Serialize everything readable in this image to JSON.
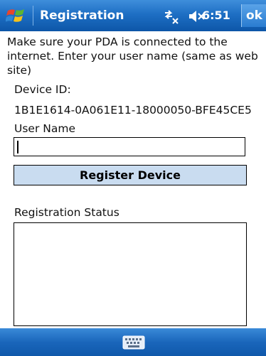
{
  "titlebar": {
    "title": "Registration",
    "time": "6:51",
    "ok_label": "ok",
    "icons": [
      "windows-start-icon",
      "connectivity-icon",
      "volume-muted-icon"
    ]
  },
  "form": {
    "instructions": "Make sure your PDA is connected to the internet. Enter your user name (same as web site)",
    "device_id_label": "Device ID:",
    "device_id_value": "1B1E1614-0A061E11-18000050-BFE45CE5",
    "user_name_label": "User Name",
    "user_name_value": "",
    "register_button_label": "Register Device",
    "status_label": "Registration Status",
    "status_value": ""
  },
  "bottombar": {
    "icons": [
      "keyboard-icon"
    ]
  },
  "colors": {
    "titlebar_blue": "#1e6fc4",
    "button_fill": "#c9dcf0"
  }
}
